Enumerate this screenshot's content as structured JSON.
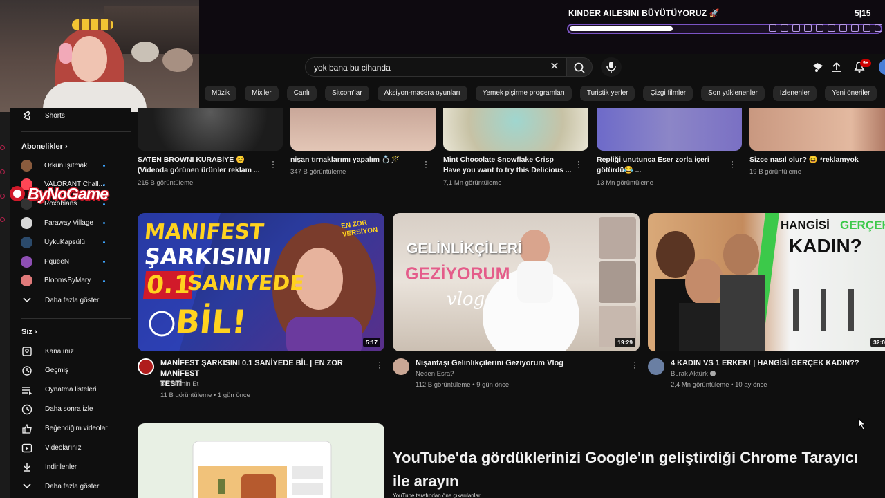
{
  "stream_overlay": {
    "sub_goal_title": "KINDER AILESINI BÜYÜTÜYORUZ 🚀",
    "sub_goal_count": "5|15",
    "sub_goal_progress": 0.33,
    "sponsor_logo": "ByNoGame"
  },
  "search": {
    "query": "yok bana bu cihanda",
    "clear_icon": "close-icon",
    "search_icon": "search-icon",
    "mic_icon": "mic-icon"
  },
  "header": {
    "notifications_badge": "9+"
  },
  "chips": [
    "Müzik",
    "Mix'ler",
    "Canlı",
    "Sitcom'lar",
    "Aksiyon-macera oyunları",
    "Yemek pişirme programları",
    "Turistik yerler",
    "Çizgi filmler",
    "Son yüklenenler",
    "İzlenenler",
    "Yeni öneriler"
  ],
  "sidebar": {
    "shorts_label": "Shorts",
    "subscriptions_heading": "Abonelikler",
    "subscriptions": [
      {
        "name": "Orkun Işıtmak",
        "color": "#8a5b3d"
      },
      {
        "name": "VALORANT Chall...",
        "color": "#ff4655"
      },
      {
        "name": "Roxobians",
        "color": "#333333"
      },
      {
        "name": "Faraway Village",
        "color": "#d8d8d8"
      },
      {
        "name": "UykuKapsülü",
        "color": "#2b4a6b"
      },
      {
        "name": "PqueeN",
        "color": "#8e4fb4"
      },
      {
        "name": "BloomsByMary",
        "color": "#e07a7a"
      }
    ],
    "show_more": "Daha fazla göster",
    "you_heading": "Siz",
    "you_items": [
      {
        "label": "Kanalınız",
        "icon": "channel-icon"
      },
      {
        "label": "Geçmiş",
        "icon": "history-icon"
      },
      {
        "label": "Oynatma listeleri",
        "icon": "playlist-icon"
      },
      {
        "label": "Daha sonra izle",
        "icon": "clock-icon"
      },
      {
        "label": "Beğendiğim videolar",
        "icon": "thumbs-up-icon"
      },
      {
        "label": "Videolarınız",
        "icon": "video-icon"
      },
      {
        "label": "İndirilenler",
        "icon": "download-icon"
      },
      {
        "label": "Daha fazla göster",
        "icon": "chevron-down-icon"
      }
    ]
  },
  "shorts": [
    {
      "title_1": "SATEN BROWNI KURABİYE 😊",
      "title_2": "(Videoda  görünen ürünler reklam ...",
      "views": "215 B görüntüleme"
    },
    {
      "title_1": "nişan tırnaklarımı yapalım 💍🪄",
      "title_2": "",
      "views": "347 B görüntüleme"
    },
    {
      "title_1": "Mint Chocolate Snowflake Crisp",
      "title_2": "Have you want to try this Delicious ...",
      "views": "7,1 Mn görüntüleme"
    },
    {
      "title_1": "Repliği unutunca Eser zorla içeri",
      "title_2": "götürdü😂 ...",
      "views": "13 Mn görüntüleme"
    },
    {
      "title_1": "Sizce nasıl olur? 😆  *reklamyok",
      "title_2": "",
      "views": "19 B görüntüleme"
    }
  ],
  "videos": [
    {
      "title_1": "MANİFEST ŞARKISINI 0.1 SANİYEDE BİL | EN ZOR MANİFEST",
      "title_2": "TESTİ",
      "channel": "Bil Tahmin Et",
      "views": "11 B görüntüleme",
      "age": "1 gün önce",
      "duration": "5:17",
      "thumb_text": {
        "l1": "MANIFEST",
        "l2": "ŞARKISINI",
        "l3": "0.1",
        "l4": "SANIYEDE",
        "l5": "BİL!",
        "badge": "EN ZOR VERSİYON"
      }
    },
    {
      "title_1": "Nişantaşı Gelinlikçilerini Geziyorum Vlog",
      "channel": "Neden Esra?",
      "views": "112 B görüntüleme",
      "age": "9 gün önce",
      "duration": "19:29",
      "thumb_text": {
        "l1": "GELİNLİKÇİLERİ",
        "l2": "GEZİYORUM",
        "l3": "vlog"
      }
    },
    {
      "title_1": "4 KADIN VS 1 ERKEK! | HANGİSİ GERÇEK KADIN??",
      "channel": "Burak Aktürk",
      "views": "2,4 Mn görüntüleme",
      "age": "10 ay önce",
      "duration": "32:0",
      "thumb_text": {
        "l1a": "HANGİSİ",
        "l1b": "GERÇEK",
        "l2": "KADIN?"
      }
    }
  ],
  "promo": {
    "title": "YouTube'da gördüklerinizi Google'ın geliştirdiği Chrome Tarayıcı ile arayın",
    "subtitle": "YouTube tarafından öne çıkarılanlar"
  },
  "separator": " • "
}
